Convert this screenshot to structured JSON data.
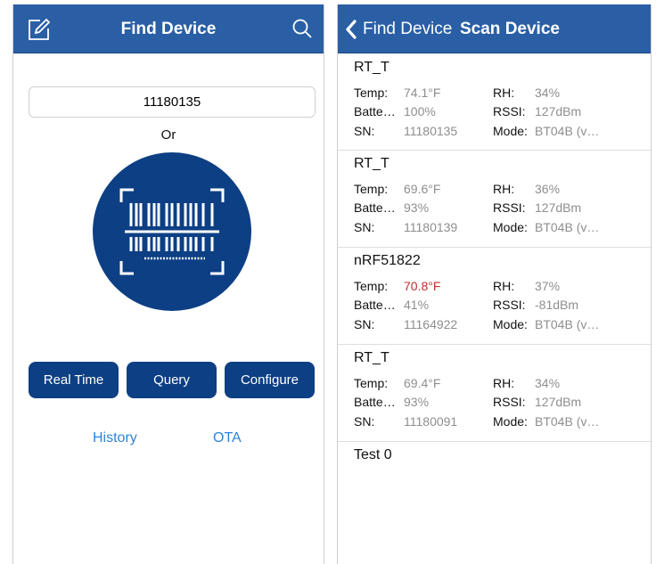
{
  "left": {
    "title": "Find Device",
    "serial_input": {
      "value": "11180135"
    },
    "or_label": "Or",
    "buttons": {
      "real_time": "Real Time",
      "query": "Query",
      "configure": "Configure"
    },
    "links": {
      "history": "History",
      "ota": "OTA"
    }
  },
  "right": {
    "back_label": "Find Device",
    "title": "Scan Device",
    "labels": {
      "temp": "Temp:",
      "battery": "Batte…",
      "sn": "SN:",
      "rh": "RH:",
      "rssi": "RSSI:",
      "mode": "Mode:"
    },
    "devices": [
      {
        "name": "RT_T",
        "temp": "74.1°F",
        "battery": "100%",
        "sn": "11180135",
        "rh": "34%",
        "rssi": "127dBm",
        "mode": "BT04B (v…"
      },
      {
        "name": "RT_T",
        "temp": "69.6°F",
        "battery": "93%",
        "sn": "11180139",
        "rh": "36%",
        "rssi": "127dBm",
        "mode": "BT04B (v…"
      },
      {
        "name": "nRF51822",
        "temp": "70.8°F",
        "temp_alert": true,
        "battery": "41%",
        "sn": "11164922",
        "rh": "37%",
        "rssi": "-81dBm",
        "mode": "BT04B (v…"
      },
      {
        "name": "RT_T",
        "temp": "69.4°F",
        "battery": "93%",
        "sn": "11180091",
        "rh": "34%",
        "rssi": "127dBm",
        "mode": "BT04B (v…"
      },
      {
        "name": "Test 0"
      }
    ]
  },
  "colors": {
    "nav_bar": "#2a5fa5",
    "button": "#0d3f84",
    "link": "#2e84d8",
    "alert_value": "#c0302a"
  }
}
